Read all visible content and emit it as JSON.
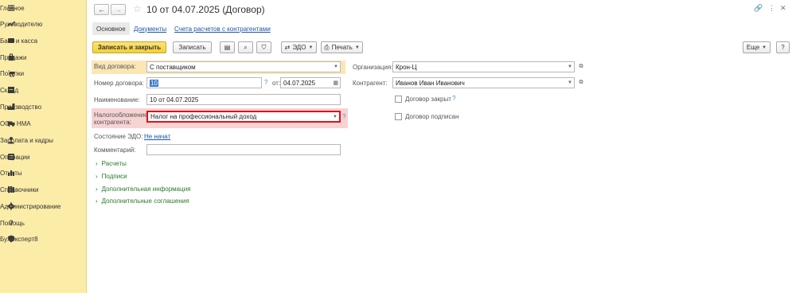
{
  "sidebar": {
    "items": [
      {
        "label": "Главное",
        "icon": "menu-icon"
      },
      {
        "label": "Руководителю",
        "icon": "trend-icon"
      },
      {
        "label": "Банк и касса",
        "icon": "bank-icon"
      },
      {
        "label": "Продажи",
        "icon": "bag-icon"
      },
      {
        "label": "Покупки",
        "icon": "cart-icon"
      },
      {
        "label": "Склад",
        "icon": "warehouse-icon"
      },
      {
        "label": "Производство",
        "icon": "factory-icon"
      },
      {
        "label": "ОС и НМА",
        "icon": "truck-icon"
      },
      {
        "label": "Зарплата и кадры",
        "icon": "people-icon"
      },
      {
        "label": "Операции",
        "icon": "operations-icon"
      },
      {
        "label": "Отчеты",
        "icon": "bar-chart-icon"
      },
      {
        "label": "Справочники",
        "icon": "books-icon"
      },
      {
        "label": "Администрирование",
        "icon": "gear-icon"
      },
      {
        "label": "Помощь",
        "icon": "help-icon"
      },
      {
        "label": "БухЭксперт8",
        "icon": "shield-icon"
      }
    ]
  },
  "header": {
    "title": "10 от 04.07.2025 (Договор)"
  },
  "tabs": [
    {
      "label": "Основное"
    },
    {
      "label": "Документы"
    },
    {
      "label": "Счета расчетов с контрагентами"
    }
  ],
  "toolbar": {
    "save_close": "Записать и закрыть",
    "save": "Записать",
    "edo": "ЭДО",
    "print": "Печать",
    "more": "Еще",
    "help": "?"
  },
  "form": {
    "contract_type_label": "Вид договора:",
    "contract_type_value": "С поставщиком",
    "number_label": "Номер договора:",
    "number_value": "10",
    "date_label": "от:",
    "date_value": "04.07.2025",
    "name_label": "Наименование:",
    "name_value": "10 от 04.07.2025",
    "tax_label_line1": "Налогообложение",
    "tax_label_line2": "контрагента:",
    "tax_value": "Налог на профессиональный доход",
    "edo_state_label": "Состояние ЭДО:",
    "edo_state_value": "Не начат",
    "comment_label": "Комментарий:",
    "comment_value": "",
    "org_label": "Организация:",
    "org_value": "Крон-Ц",
    "counterparty_label": "Контрагент:",
    "counterparty_value": "Иванов Иван Иванович",
    "closed_label": "Договор закрыт",
    "signed_label": "Договор подписан",
    "question_mark": "?"
  },
  "groups": [
    {
      "label": "Расчеты"
    },
    {
      "label": "Подписи"
    },
    {
      "label": "Дополнительная информация"
    },
    {
      "label": "Дополнительные соглашения"
    }
  ]
}
